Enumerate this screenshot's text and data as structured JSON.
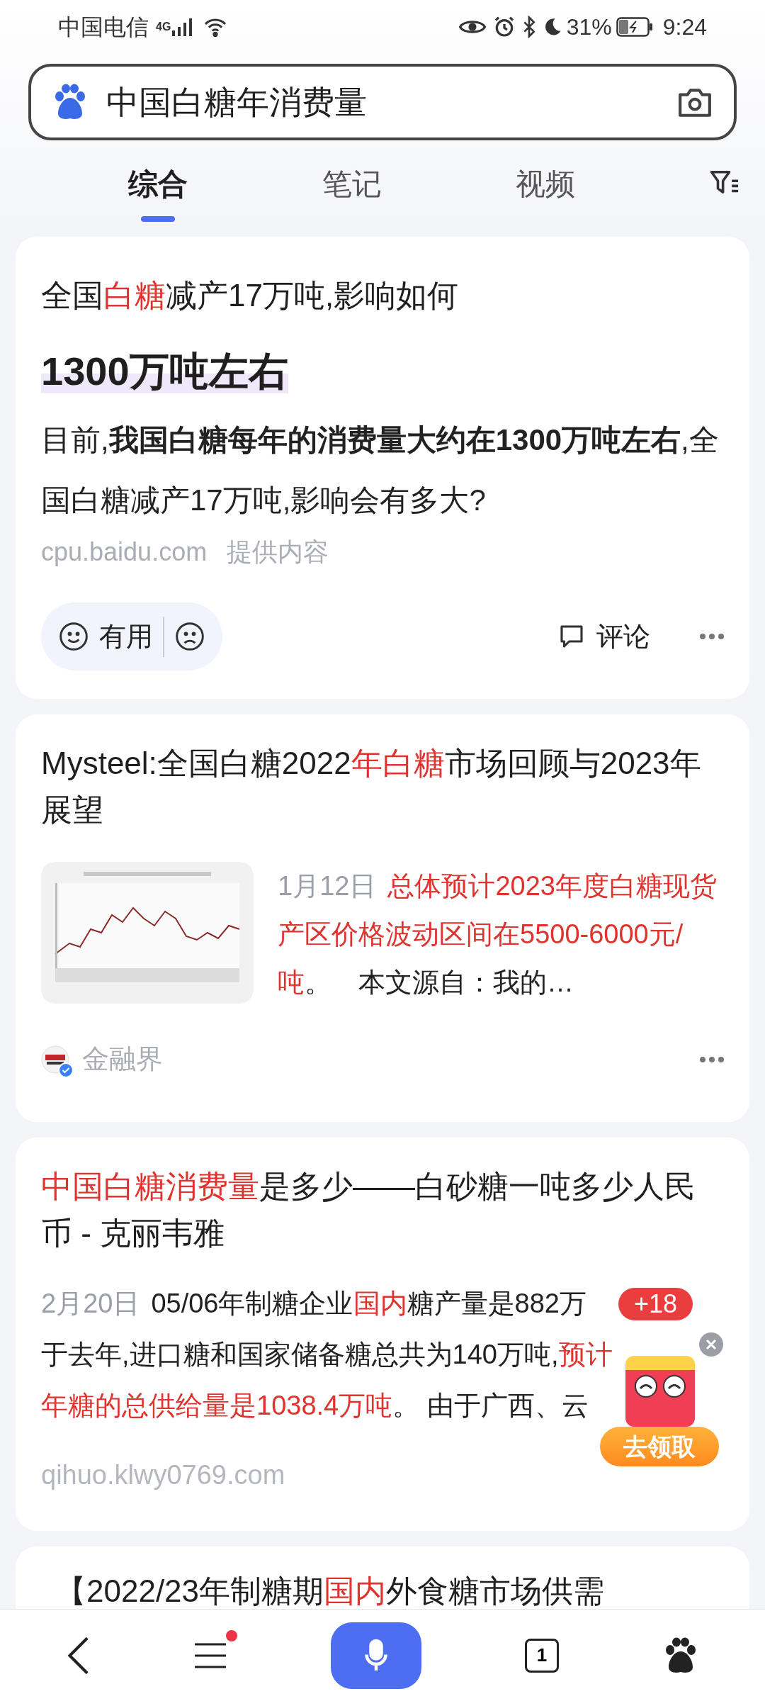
{
  "status_bar": {
    "carrier": "中国电信",
    "network": "4G",
    "battery": "31%",
    "time": "9:24"
  },
  "search": {
    "value": "中国白糖年消费量"
  },
  "tabs": [
    {
      "label": "综合",
      "selected": true
    },
    {
      "label": "笔记",
      "selected": false
    },
    {
      "label": "视频",
      "selected": false
    }
  ],
  "results": [
    {
      "kind": "answer",
      "title": [
        {
          "text": "全国",
          "highlight": false
        },
        {
          "text": "白糖",
          "highlight": true
        },
        {
          "text": "减产17万吨,影响如何",
          "highlight": false
        }
      ],
      "answer": "1300万吨左右",
      "body": "目前,**我国白糖每年的消费量大约在1300万吨左右**,全国白糖减产17万吨,影响会有多大?",
      "source": "cpu.baidu.com",
      "source_note": "提供内容",
      "useful": "有用",
      "comment": "评论"
    },
    {
      "kind": "article",
      "title": [
        {
          "text": "Mysteel:全国白糖2022",
          "highlight": false
        },
        {
          "text": "年白糖",
          "highlight": true
        },
        {
          "text": "市场回顾与2023年展望",
          "highlight": false
        }
      ],
      "thumbnail": {
        "kind": "picture"
      },
      "snippet": [
        {
          "text": "1月12日",
          "kind": "date"
        },
        {
          "text": "总体预计2023年度白糖现货产区价格波动区间在5500-6000元/吨",
          "kind": "highlight"
        },
        {
          "text": "。　本文源自：我的…",
          "kind": "plain"
        }
      ],
      "author": "金融界",
      "verified": true
    },
    {
      "kind": "snippet",
      "title": [
        {
          "text": "中国白糖消费量",
          "highlight": true
        },
        {
          "text": "是多少——白砂糖一吨多少人民币 - 克丽韦雅",
          "highlight": false
        }
      ],
      "snippet_lines": [
        [
          {
            "text": "2月20日",
            "kind": "date"
          },
          {
            "text": "05/06年制糖企业",
            "kind": "plain"
          },
          {
            "text": "国内",
            "kind": "highlight"
          },
          {
            "text": "糖产量是882万",
            "kind": "plain"
          }
        ],
        [
          {
            "text": "于去年,进口糖和国家储备糖总共为140万吨,",
            "kind": "plain"
          },
          {
            "text": "预计",
            "kind": "highlight"
          }
        ],
        [
          {
            "text": "年糖的总供给量是1038.4万吨",
            "kind": "highlight"
          },
          {
            "text": "。 由于广西、云",
            "kind": "plain"
          }
        ]
      ],
      "source": "qihuo.klwy0769.com"
    },
    {
      "kind": "partial",
      "title": [
        {
          "text": "【2022/23年制糖期",
          "highlight": false
        },
        {
          "text": "国内",
          "highlight": true
        },
        {
          "text": "外食糖市场供需",
          "highlight": false
        }
      ]
    }
  ],
  "reward": {
    "badge": "+18",
    "button": "去领取"
  },
  "nav": {
    "menu_notification": true,
    "tab_count": "1"
  }
}
